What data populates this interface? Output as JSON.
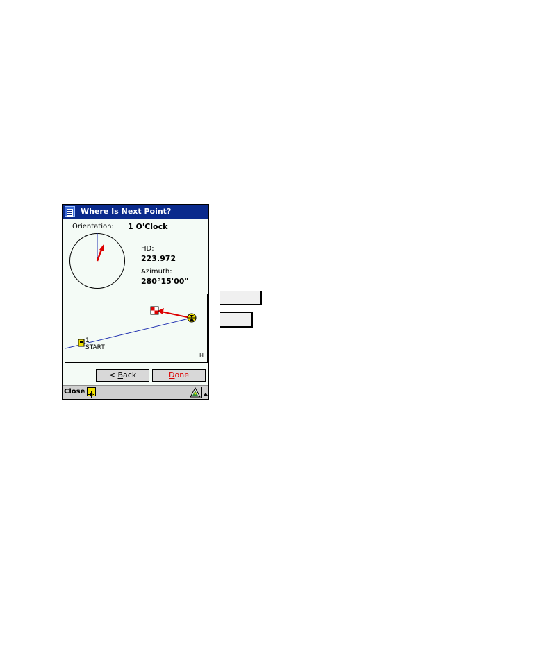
{
  "window": {
    "title": "Where Is Next Point?"
  },
  "orientation": {
    "label": "Orientation:",
    "value": "1 O'Clock"
  },
  "distance": {
    "label": "HD:",
    "value": "223.972"
  },
  "azimuth": {
    "label": "Azimuth:",
    "value": "280°15'00\""
  },
  "map": {
    "start_number": "1",
    "start_label": "START",
    "corner_label": "H"
  },
  "buttons": {
    "back_label": "< Back",
    "back_hotkey": "B",
    "done_label": "Done",
    "done_hotkey": "D"
  },
  "taskbar": {
    "close_label": "Close"
  },
  "colors": {
    "title_bar": "#0a2a8c",
    "accent_red": "#dd0000",
    "route_line": "#1f2fb0",
    "background": "#f4fbf6"
  }
}
